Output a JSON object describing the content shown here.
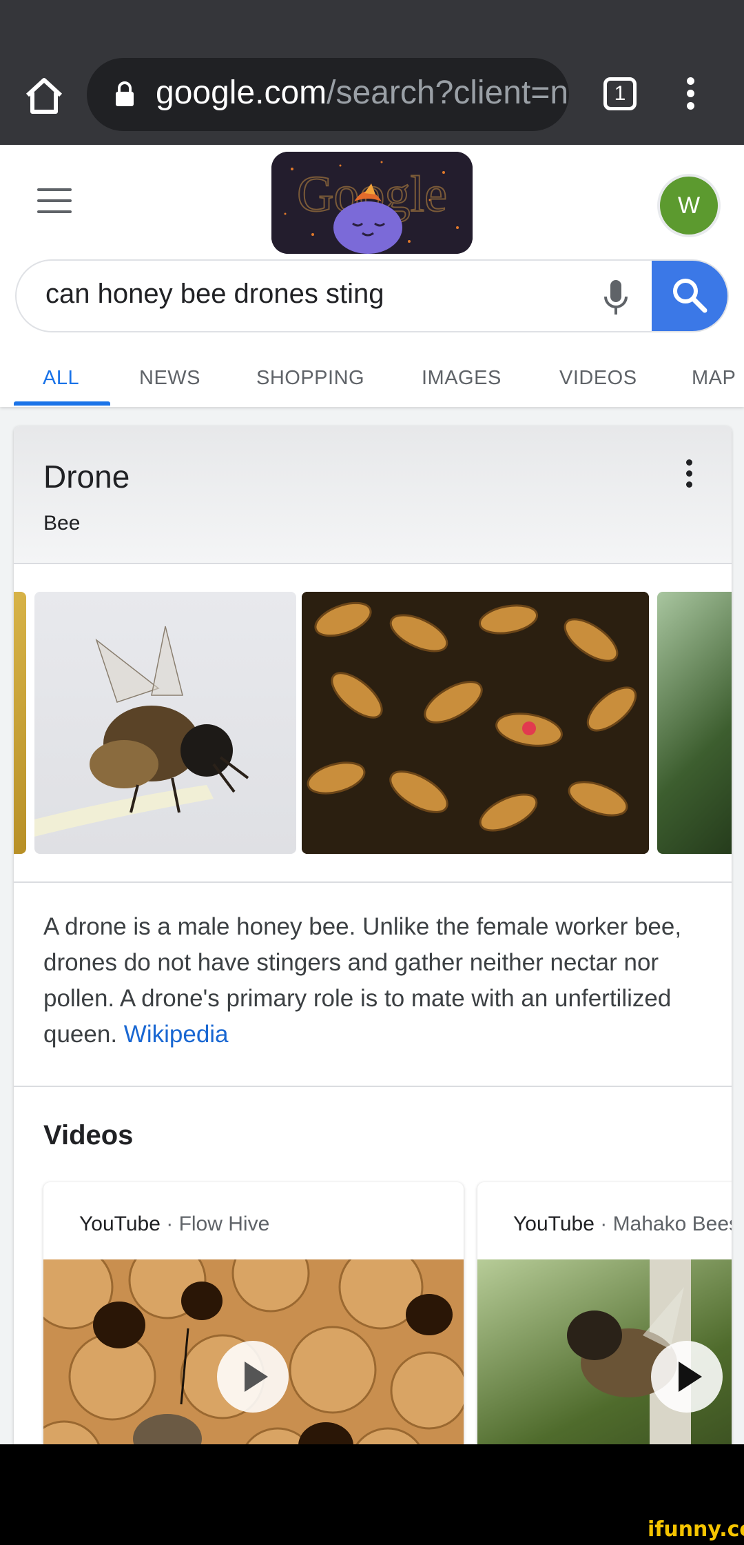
{
  "browser": {
    "url_host": "google.com",
    "url_rest": "/search?client=n",
    "tab_count": "1",
    "icons": [
      "home-icon",
      "lock-icon",
      "tabs-icon",
      "more-vert-icon"
    ]
  },
  "search": {
    "query": "can honey bee drones sting",
    "avatar_letter": "W",
    "doodle_text": "Google",
    "tabs": [
      "ALL",
      "NEWS",
      "SHOPPING",
      "IMAGES",
      "VIDEOS",
      "MAP"
    ],
    "active_tab": "ALL",
    "accent": "#1a73e8",
    "search_button_color": "#3b78e7"
  },
  "knowledge": {
    "title": "Drone",
    "subtitle": "Bee",
    "description": "A drone is a male honey bee. Unlike the female worker bee, drones do not have stingers and gather neither nectar nor pollen. A drone's primary role is to mate with an unfertilized queen.",
    "source_link": "Wikipedia",
    "videos_heading": "Videos",
    "videos": [
      {
        "source": "YouTube",
        "separator": " · ",
        "channel": "Flow Hive"
      },
      {
        "source": "YouTube",
        "separator": " · ",
        "channel": "Mahako Bees"
      }
    ]
  },
  "watermark": "ifunny.co"
}
